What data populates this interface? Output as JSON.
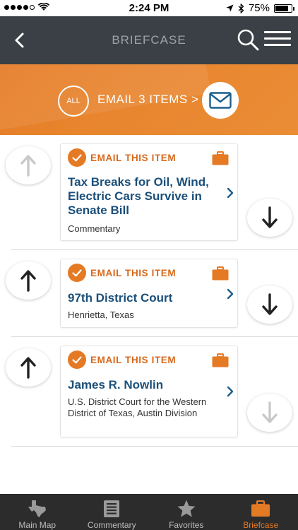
{
  "status_bar": {
    "time": "2:24 PM",
    "battery": "75%",
    "signal_bars_filled": 4
  },
  "header": {
    "title": "BRIEFCASE"
  },
  "email_banner": {
    "all_label": "ALL",
    "email_label": "EMAIL 3 ITEMS >"
  },
  "items": [
    {
      "email_label": "EMAIL THIS ITEM",
      "title": "Tax Breaks for Oil, Wind, Electric Cars Survive in Senate Bill",
      "subtitle": "Commentary"
    },
    {
      "email_label": "EMAIL THIS ITEM",
      "title": "97th District Court",
      "subtitle": "Henrietta, Texas"
    },
    {
      "email_label": "EMAIL THIS ITEM",
      "title": "James R. Nowlin",
      "subtitle": "U.S. District Court for the Western District of Texas, Austin Division"
    }
  ],
  "tabs": [
    {
      "label": "Main Map",
      "icon": "texas-icon"
    },
    {
      "label": "Commentary",
      "icon": "document-icon"
    },
    {
      "label": "Favorites",
      "icon": "star-icon"
    },
    {
      "label": "Briefcase",
      "icon": "briefcase-icon",
      "active": true
    }
  ],
  "colors": {
    "accent": "#e57a25",
    "header_bg": "#3a4045",
    "title_blue": "#1b4f7a",
    "tabbar_bg": "#2c2c2c"
  }
}
